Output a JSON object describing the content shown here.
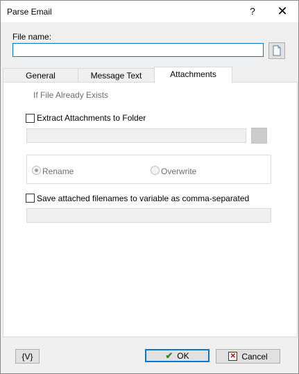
{
  "window": {
    "title": "Parse Email",
    "help_label": "?",
    "close_label": "✕"
  },
  "file": {
    "label": "File name:",
    "value": "",
    "browse_icon": "document-icon"
  },
  "tabs": [
    {
      "label": "General"
    },
    {
      "label": "Message Text"
    },
    {
      "label": "Attachments",
      "active": true
    }
  ],
  "attachments": {
    "extract_label": "Extract Attachments to Folder",
    "extract_checked": false,
    "folder_value": "",
    "group_title": "If File Already Exists",
    "rename_label": "Rename",
    "overwrite_label": "Overwrite",
    "selected_option": "Rename",
    "save_names_label": "Save attached filenames to variable as comma-separated",
    "save_names_checked": false,
    "variable_value": ""
  },
  "footer": {
    "variables_label": "{V}",
    "ok_label": "OK",
    "cancel_label": "Cancel"
  },
  "colors": {
    "accent": "#0078d7",
    "panel": "#f0f0f0"
  }
}
